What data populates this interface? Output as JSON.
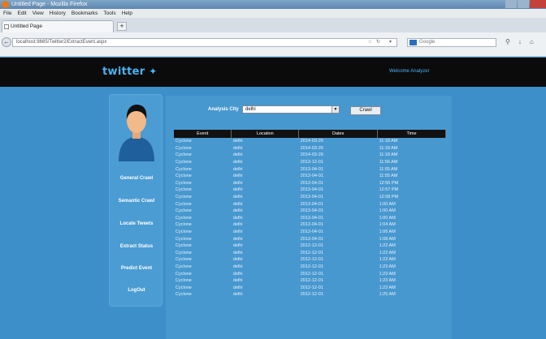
{
  "window": {
    "title": "Untitled Page - Mozilla Firefox"
  },
  "menu": [
    "File",
    "Edit",
    "View",
    "History",
    "Bookmarks",
    "Tools",
    "Help"
  ],
  "tab": {
    "title": "Untitled Page",
    "new_tab": "+"
  },
  "url": "localhost:8665/Twitter2/ExtractEvent.aspx",
  "search": {
    "placeholder": "Google"
  },
  "brand": {
    "logo": "twitter",
    "welcome": "Welcome Analyzer"
  },
  "sidebar": {
    "items": [
      "General Crawl",
      "Semantic Crawl",
      "Locate Tweets",
      "Extract Status",
      "Predict Event",
      "LogOut"
    ]
  },
  "filter": {
    "label": "Analysis City",
    "selected": "delhi",
    "button": "Crawl"
  },
  "table": {
    "headers": [
      "Event",
      "Location",
      "Dates",
      "Time"
    ],
    "rows": [
      [
        "Cyclone",
        "delhi",
        "2014-03-26",
        "11:18 AM"
      ],
      [
        "Cyclone",
        "delhi",
        "2014-03-26",
        "11:18 AM"
      ],
      [
        "Cyclone",
        "delhi",
        "2014-03-26",
        "11:18 AM"
      ],
      [
        "Cyclone",
        "delhi",
        "2013-12-01",
        "11:56 AM"
      ],
      [
        "Cyclone",
        "delhi",
        "2013-04-01",
        "11:55 AM"
      ],
      [
        "Cyclone",
        "delhi",
        "2013-04-01",
        "11:55 AM"
      ],
      [
        "Cyclone",
        "delhi",
        "2013-04-01",
        "12:56 PM"
      ],
      [
        "Cyclone",
        "delhi",
        "2013-04-01",
        "12:57 PM"
      ],
      [
        "Cyclone",
        "delhi",
        "2013-04-01",
        "12:58 PM"
      ],
      [
        "Cyclone",
        "delhi",
        "2013-04-01",
        "1:00 AM"
      ],
      [
        "Cyclone",
        "delhi",
        "2013-04-01",
        "1:00 AM"
      ],
      [
        "Cyclone",
        "delhi",
        "2013-04-01",
        "1:00 AM"
      ],
      [
        "Cyclone",
        "delhi",
        "2013-04-01",
        "1:04 AM"
      ],
      [
        "Cyclone",
        "delhi",
        "2013-04-01",
        "1:06 AM"
      ],
      [
        "Cyclone",
        "delhi",
        "2013-04-01",
        "1:08 AM"
      ],
      [
        "Cyclone",
        "delhi",
        "2012-12-01",
        "1:22 AM"
      ],
      [
        "Cyclone",
        "delhi",
        "2012-12-01",
        "1:22 AM"
      ],
      [
        "Cyclone",
        "delhi",
        "2012-12-01",
        "1:22 AM"
      ],
      [
        "Cyclone",
        "delhi",
        "2012-12-01",
        "1:23 AM"
      ],
      [
        "Cyclone",
        "delhi",
        "2012-12-01",
        "1:23 AM"
      ],
      [
        "Cyclone",
        "delhi",
        "2012-12-01",
        "1:23 AM"
      ],
      [
        "Cyclone",
        "delhi",
        "2012-12-01",
        "1:23 AM"
      ],
      [
        "Cyclone",
        "delhi",
        "2012-12-01",
        "1:25 AM"
      ]
    ]
  }
}
